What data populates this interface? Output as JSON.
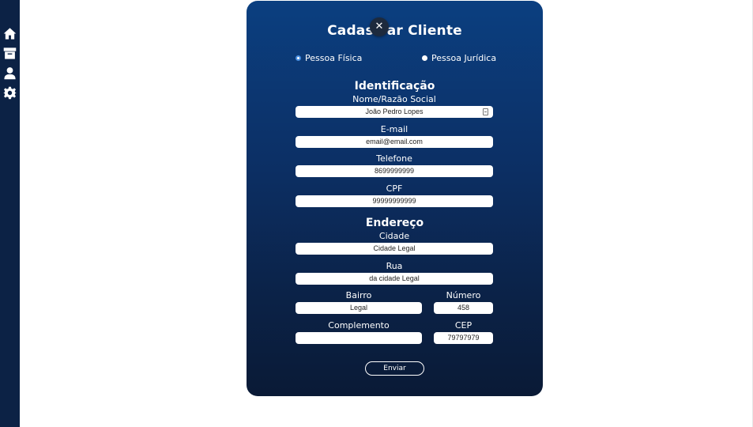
{
  "sidebar": {
    "icons": [
      "home-icon",
      "archive-icon",
      "user-icon",
      "gear-icon"
    ]
  },
  "modal": {
    "title": "Cadastrar Cliente",
    "close_label": "✕",
    "person_type": {
      "options": [
        "Pessoa Física",
        "Pessoa Jurídica"
      ],
      "selected": "Pessoa Física"
    },
    "identification": {
      "heading": "Identificação",
      "name_label": "Nome/Razão Social",
      "name_value": "João Pedro Lopes",
      "email_label": "E-mail",
      "email_value": "email@email.com",
      "phone_label": "Telefone",
      "phone_value": "8699999999",
      "cpf_label": "CPF",
      "cpf_value": "99999999999"
    },
    "address": {
      "heading": "Endereço",
      "city_label": "Cidade",
      "city_value": "Cidade Legal",
      "street_label": "Rua",
      "street_value": "da cidade Legal",
      "district_label": "Bairro",
      "district_value": "Legal",
      "number_label": "Número",
      "number_value": "458",
      "complement_label": "Complemento",
      "complement_value": "",
      "cep_label": "CEP",
      "cep_value": "79797979"
    },
    "submit_label": "Enviar"
  },
  "colors": {
    "sidebar": "#0c2245",
    "modal_top": "#0b3f80",
    "modal_bottom": "#0a1a36",
    "radio_accent": "#4a8fe0"
  }
}
